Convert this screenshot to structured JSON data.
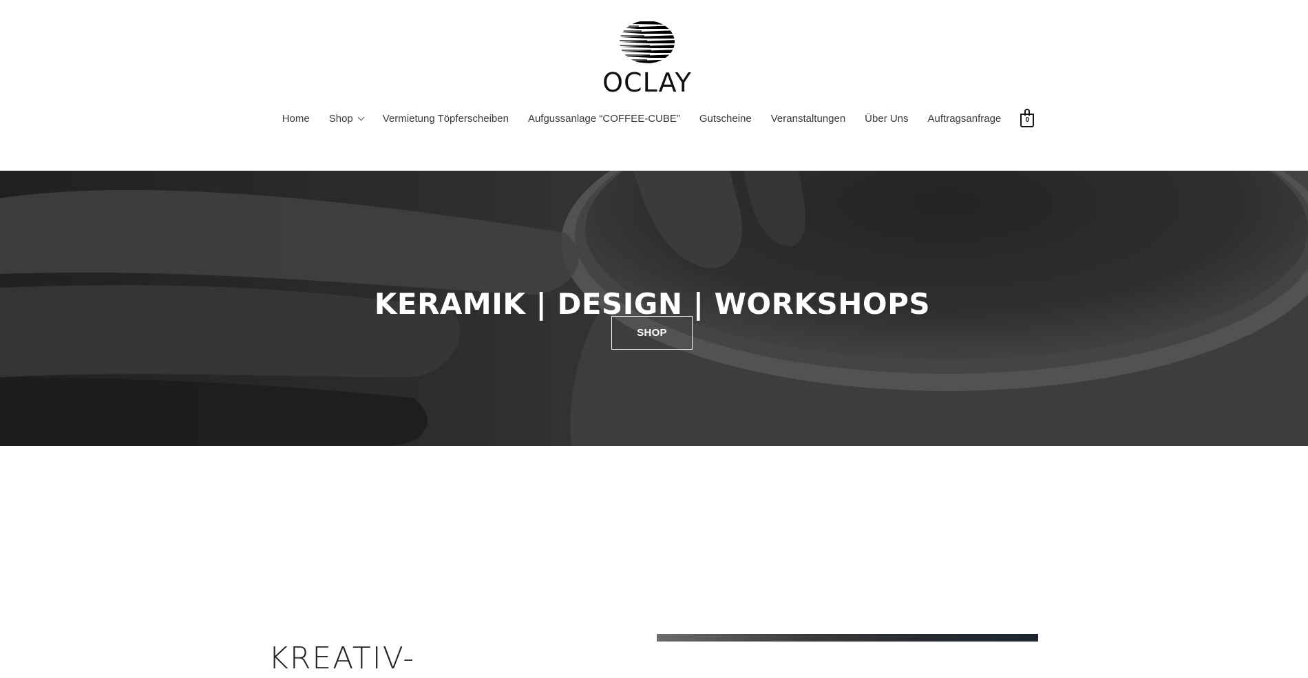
{
  "brand": {
    "name": "OCLAY",
    "logo_icon": "striped-sphere-logo-icon"
  },
  "nav": {
    "items": [
      {
        "label": "Home"
      },
      {
        "label": "Shop",
        "has_dropdown": true
      },
      {
        "label": "Vermietung Töpferscheiben"
      },
      {
        "label": "Aufgussanlage “COFFEE-CUBE”"
      },
      {
        "label": "Gutscheine"
      },
      {
        "label": "Veranstaltungen"
      },
      {
        "label": "Über Uns"
      },
      {
        "label": "Auftragsanfrage"
      }
    ],
    "cart": {
      "icon": "shopping-bag-icon",
      "count": "0"
    }
  },
  "hero": {
    "title": "KERAMIK | DESIGN | WORKSHOPS",
    "button_label": "SHOP",
    "image": "pottery-hands-on-wheel-photo"
  },
  "section": {
    "heading": "KREATIV-",
    "image": "dark-photo"
  },
  "colors": {
    "text": "#333333",
    "hero_overlay": "#3c3c3c",
    "white": "#ffffff"
  }
}
